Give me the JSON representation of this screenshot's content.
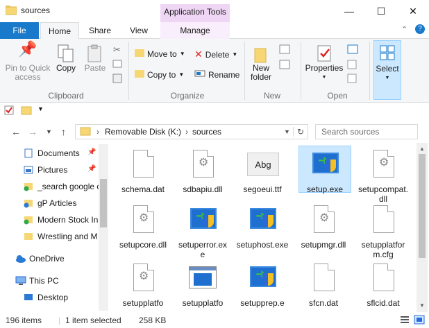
{
  "window": {
    "title": "sources",
    "context_group": "Application Tools",
    "minimize": "—",
    "maximize": "☐",
    "close": "✕"
  },
  "tabs": [
    "File",
    "Home",
    "Share",
    "View",
    "Manage"
  ],
  "ribbon": {
    "clipboard": {
      "label": "Clipboard",
      "pin": "Pin to Quick access",
      "copy": "Copy",
      "paste": "Paste"
    },
    "organize": {
      "label": "Organize",
      "move_to": "Move to",
      "copy_to": "Copy to",
      "delete": "Delete",
      "rename": "Rename"
    },
    "new": {
      "label": "New",
      "new_folder": "New folder"
    },
    "open": {
      "label": "Open",
      "properties": "Properties"
    },
    "select": {
      "label": "Select"
    }
  },
  "address": {
    "segments": [
      "Removable Disk (K:)",
      "sources"
    ],
    "search_placeholder": "Search sources"
  },
  "navpane": {
    "items": [
      {
        "label": "Documents",
        "icon": "documents-icon",
        "pinned": true
      },
      {
        "label": "Pictures",
        "icon": "pictures-icon",
        "pinned": true
      },
      {
        "label": "_search google c",
        "icon": "folder-icon"
      },
      {
        "label": "gP Articles",
        "icon": "folder-icon"
      },
      {
        "label": "Modern Stock In",
        "icon": "folder-icon"
      },
      {
        "label": "Wrestling and M",
        "icon": "folder-icon"
      },
      {
        "label": "OneDrive",
        "icon": "onedrive-icon"
      },
      {
        "label": "This PC",
        "icon": "pc-icon"
      },
      {
        "label": "Desktop",
        "icon": "desktop-icon"
      }
    ]
  },
  "files": [
    {
      "name": "schema.dat",
      "type": "doc"
    },
    {
      "name": "sdbapiu.dll",
      "type": "dll"
    },
    {
      "name": "segoeui.ttf",
      "type": "font",
      "glyph": "Abg"
    },
    {
      "name": "setup.exe",
      "type": "exe",
      "selected": true
    },
    {
      "name": "setupcompat.dll",
      "type": "dll"
    },
    {
      "name": "setupcore.dll",
      "type": "dll"
    },
    {
      "name": "setuperror.exe",
      "type": "exe"
    },
    {
      "name": "setuphost.exe",
      "type": "exe"
    },
    {
      "name": "setupmgr.dll",
      "type": "dll"
    },
    {
      "name": "setupplatform.cfg",
      "type": "doc"
    },
    {
      "name": "setupplatfo",
      "type": "dll"
    },
    {
      "name": "setupplatfo",
      "type": "window"
    },
    {
      "name": "setupprep.e",
      "type": "exe"
    },
    {
      "name": "sfcn.dat",
      "type": "doc"
    },
    {
      "name": "sflcid.dat",
      "type": "doc"
    }
  ],
  "status": {
    "items": "196 items",
    "selected": "1 item selected",
    "size": "258 KB"
  }
}
